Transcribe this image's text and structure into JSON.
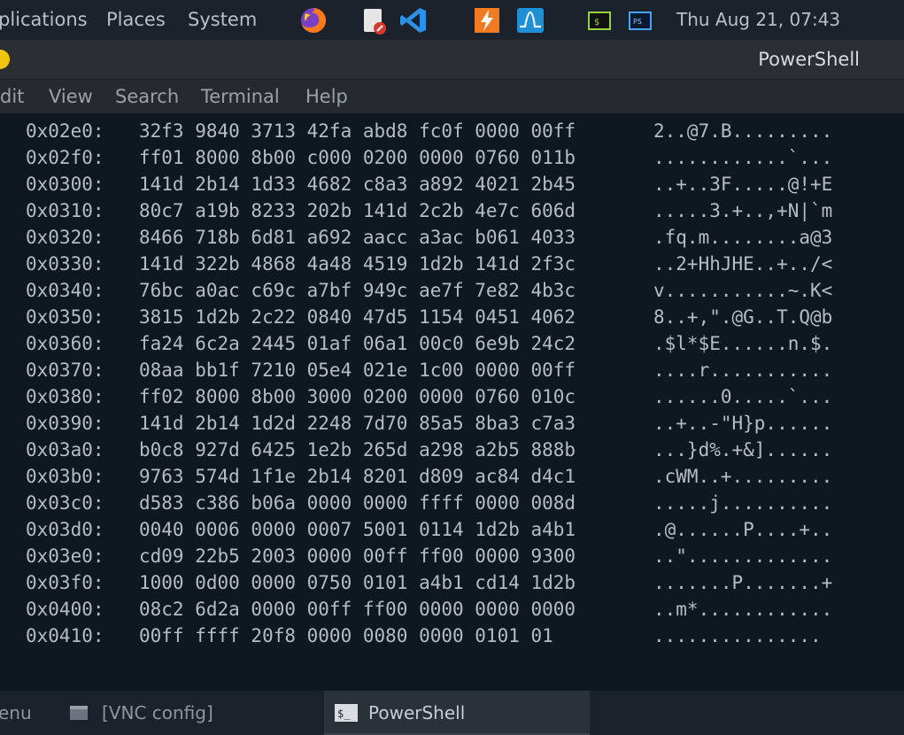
{
  "top_panel": {
    "applications_label": "plications",
    "places_label": "Places",
    "system_label": "System",
    "clock": "Thu Aug 21, 07:43",
    "launchers": [
      {
        "icon": "firefox-icon"
      },
      {
        "icon": "text-editor-icon"
      },
      {
        "icon": "vscode-icon"
      },
      {
        "icon": "burp-icon"
      },
      {
        "icon": "system-monitor-icon"
      },
      {
        "icon": "terminal-icon"
      },
      {
        "icon": "powershell-icon"
      }
    ]
  },
  "window": {
    "title": "PowerShell",
    "menu": [
      "Edit",
      "View",
      "Search",
      "Terminal",
      "Help"
    ],
    "menu_visible": [
      "dit",
      "View",
      "Search",
      "Terminal",
      "Help"
    ]
  },
  "hexdump": {
    "rows": [
      {
        "offset": "0x02e0:",
        "bytes": "32f3 9840 3713 42fa abd8 fc0f 0000 00ff",
        "ascii": "2..@7.B........."
      },
      {
        "offset": "0x02f0:",
        "bytes": "ff01 8000 8b00 c000 0200 0000 0760 011b",
        "ascii": "............`..."
      },
      {
        "offset": "0x0300:",
        "bytes": "141d 2b14 1d33 4682 c8a3 a892 4021 2b45",
        "ascii": "..+..3F.....@!+E"
      },
      {
        "offset": "0x0310:",
        "bytes": "80c7 a19b 8233 202b 141d 2c2b 4e7c 606d",
        "ascii": ".....3.+..,+N|`m"
      },
      {
        "offset": "0x0320:",
        "bytes": "8466 718b 6d81 a692 aacc a3ac b061 4033",
        "ascii": ".fq.m........a@3"
      },
      {
        "offset": "0x0330:",
        "bytes": "141d 322b 4868 4a48 4519 1d2b 141d 2f3c",
        "ascii": "..2+HhJHE..+../<"
      },
      {
        "offset": "0x0340:",
        "bytes": "76bc a0ac c69c a7bf 949c ae7f 7e82 4b3c",
        "ascii": "v...........~.K<"
      },
      {
        "offset": "0x0350:",
        "bytes": "3815 1d2b 2c22 0840 47d5 1154 0451 4062",
        "ascii": "8..+,\".@G..T.Q@b"
      },
      {
        "offset": "0x0360:",
        "bytes": "fa24 6c2a 2445 01af 06a1 00c0 6e9b 24c2",
        "ascii": ".$l*$E......n.$."
      },
      {
        "offset": "0x0370:",
        "bytes": "08aa bb1f 7210 05e4 021e 1c00 0000 00ff",
        "ascii": "....r..........."
      },
      {
        "offset": "0x0380:",
        "bytes": "ff02 8000 8b00 3000 0200 0000 0760 010c",
        "ascii": "......0.....`..."
      },
      {
        "offset": "0x0390:",
        "bytes": "141d 2b14 1d2d 2248 7d70 85a5 8ba3 c7a3",
        "ascii": "..+..-\"H}p......"
      },
      {
        "offset": "0x03a0:",
        "bytes": "b0c8 927d 6425 1e2b 265d a298 a2b5 888b",
        "ascii": "...}d%.+&]......"
      },
      {
        "offset": "0x03b0:",
        "bytes": "9763 574d 1f1e 2b14 8201 d809 ac84 d4c1",
        "ascii": ".cWM..+........."
      },
      {
        "offset": "0x03c0:",
        "bytes": "d583 c386 b06a 0000 0000 ffff 0000 008d",
        "ascii": ".....j.........."
      },
      {
        "offset": "0x03d0:",
        "bytes": "0040 0006 0000 0007 5001 0114 1d2b a4b1",
        "ascii": ".@......P....+.."
      },
      {
        "offset": "0x03e0:",
        "bytes": "cd09 22b5 2003 0000 00ff ff00 0000 9300",
        "ascii": "..\"............."
      },
      {
        "offset": "0x03f0:",
        "bytes": "1000 0d00 0000 0750 0101 a4b1 cd14 1d2b",
        "ascii": ".......P.......+"
      },
      {
        "offset": "0x0400:",
        "bytes": "08c2 6d2a 0000 00ff ff00 0000 0000 0000",
        "ascii": "..m*............"
      },
      {
        "offset": "0x0410:",
        "bytes": "00ff ffff 20f8 0000 0080 0000 0101 01",
        "ascii": "..............."
      }
    ]
  },
  "taskbar": {
    "menu_label": "enu",
    "vnc_label": "[VNC config]",
    "powershell_label": "PowerShell"
  },
  "colors": {
    "terminal_bg": "#0f1720",
    "panel_bg": "#1b222b",
    "text": "#b6bcc6",
    "accent_yellow": "#f1c40f",
    "vscode_blue": "#2d8fe6",
    "burp_orange": "#f07b23"
  }
}
